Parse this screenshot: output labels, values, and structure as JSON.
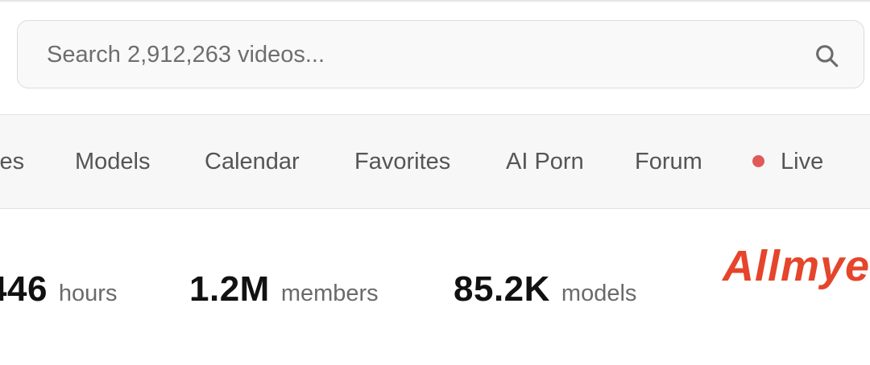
{
  "search": {
    "placeholder": "Search 2,912,263 videos..."
  },
  "icons": {
    "search": "search-icon",
    "live": "live-dot-icon"
  },
  "colors": {
    "live_dot": "#e05a5a",
    "brand": "#e5452b"
  },
  "nav": {
    "items": [
      {
        "label": "ies"
      },
      {
        "label": "Models"
      },
      {
        "label": "Calendar"
      },
      {
        "label": "Favorites"
      },
      {
        "label": "AI Porn"
      },
      {
        "label": "Forum"
      },
      {
        "label": "Live"
      }
    ]
  },
  "stats": [
    {
      "value": "446",
      "label": "hours"
    },
    {
      "value": "1.2M",
      "label": "members"
    },
    {
      "value": "85.2K",
      "label": "models"
    }
  ],
  "brand": {
    "text": "Allmye"
  }
}
